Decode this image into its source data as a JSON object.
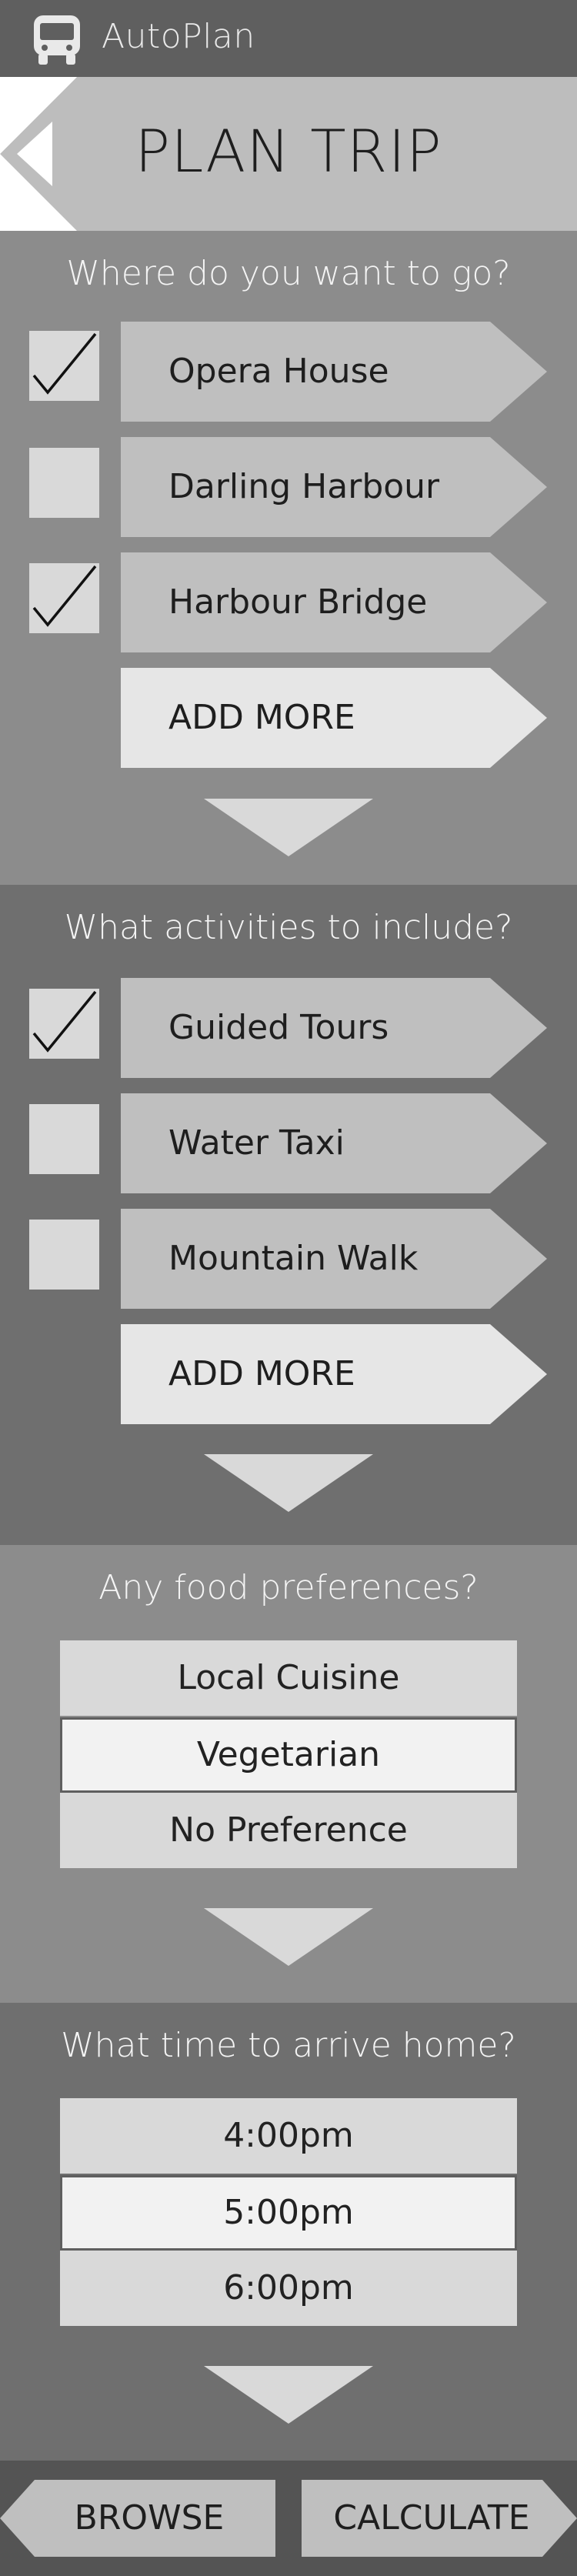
{
  "app": {
    "name": "AutoPlan",
    "icon": "bus-icon"
  },
  "header": {
    "title": "PLAN TRIP",
    "back_icon": "back-arrow-icon"
  },
  "destinations": {
    "question": "Where do you want to go?",
    "items": [
      {
        "label": "Opera House",
        "checked": true
      },
      {
        "label": "Darling Harbour",
        "checked": false
      },
      {
        "label": "Harbour Bridge",
        "checked": true
      }
    ],
    "add_more": "ADD MORE"
  },
  "activities": {
    "question": "What activities to include?",
    "items": [
      {
        "label": "Guided Tours",
        "checked": true
      },
      {
        "label": "Water Taxi",
        "checked": false
      },
      {
        "label": "Mountain Walk",
        "checked": false
      }
    ],
    "add_more": "ADD MORE"
  },
  "food": {
    "question": "Any food preferences?",
    "options": [
      "Local Cuisine",
      "Vegetarian",
      "No Preference"
    ],
    "selected": "Vegetarian"
  },
  "arrival": {
    "question": "What time to arrive home?",
    "options": [
      "4:00pm",
      "5:00pm",
      "6:00pm"
    ],
    "selected": "5:00pm"
  },
  "footer": {
    "browse": "BROWSE",
    "calculate": "CALCULATE"
  },
  "colors": {
    "dark_bar": "#5f5f5f",
    "header_bg": "#bdbdbd",
    "section_light": "#8c8c8c",
    "section_dark": "#6f6f6f",
    "item_gray": "#bfbfbf",
    "item_light": "#e6e6e6",
    "option_gray": "#d9d9d9",
    "option_selected": "#f2f2f2"
  }
}
